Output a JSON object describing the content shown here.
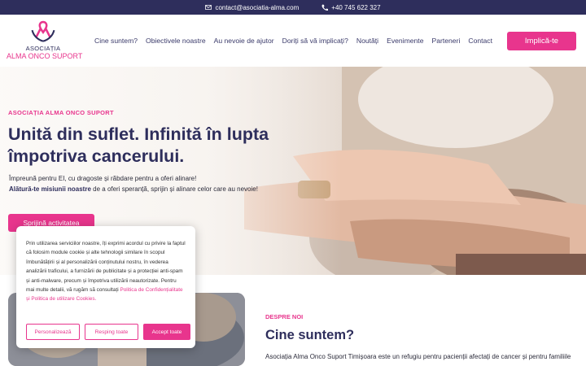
{
  "topbar": {
    "email": "contact@asociatia-alma.com",
    "phone": "+40 745 622 327"
  },
  "logo": {
    "line1": "ASOCIAȚIA",
    "line2": "ALMA ONCO SUPORT"
  },
  "nav": [
    "Cine suntem?",
    "Obiectivele noastre",
    "Au nevoie de ajutor",
    "Doriți să vă implicați?",
    "Noutăți",
    "Evenimente",
    "Parteneri",
    "Contact"
  ],
  "cta": "Implică-te",
  "hero": {
    "kicker": "ASOCIAȚIA ALMA ONCO SUPORT",
    "title": "Unită din suflet. Infinită în lupta împotriva cancerului.",
    "line1": "Împreună pentru EI, cu dragoste și răbdare pentru a oferi alinare!",
    "line2_bold": "Alătură-te misiunii noastre",
    "line2_rest": " de a oferi speranță, sprijin și alinare celor care au nevoie!",
    "button": "Sprijină activitatea"
  },
  "about": {
    "kicker": "DESPRE NOI",
    "title": "Cine suntem?",
    "text": "Asociația Alma Onco Suport Timișoara este un refugiu pentru pacienții afectați de cancer și pentru familiile"
  },
  "cookie": {
    "text": "Prin utilizarea serviciilor noastre, îți exprimi acordul cu privire la faptul că folosim module cookie și alte tehnologii similare în scopul îmbunătățirii și al personalizării conținutului nostru, în vederea analizării traficului, a furnizării de publicitate și a protecției anti-spam și anti-malware, precum și împotriva utilizării neautorizate. Pentru mai multe detalii, vă rugăm să consultați ",
    "link": "Politica de Confidențialitate și Politica de utilizare Cookies.",
    "customize": "Personalizează",
    "reject": "Resping toate",
    "accept": "Accept toate"
  },
  "colors": {
    "brand_pink": "#e8358d",
    "navy": "#2e2e5c"
  }
}
